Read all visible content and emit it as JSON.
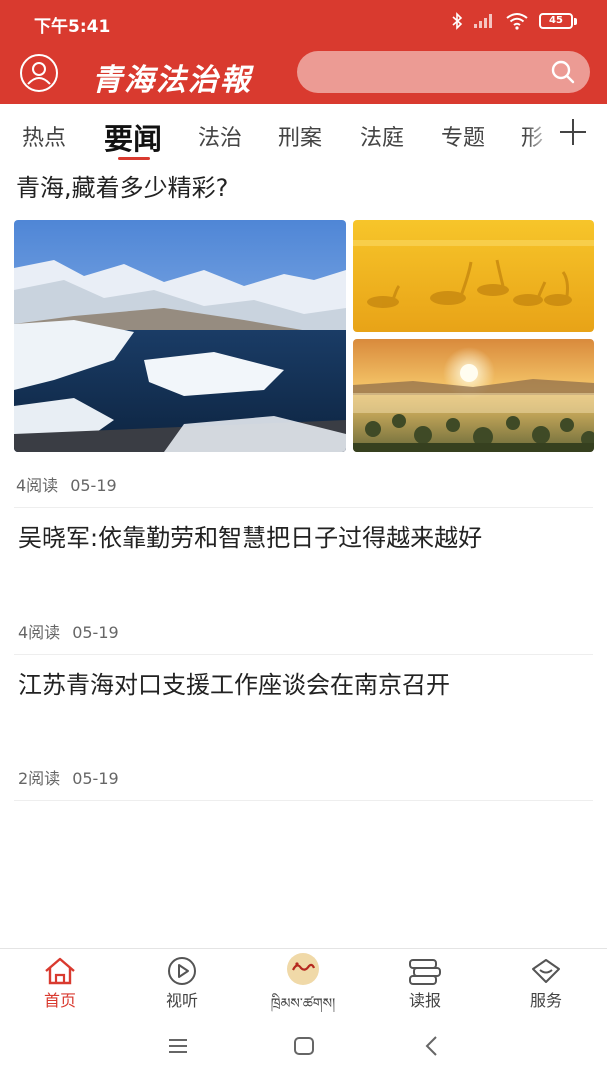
{
  "status_bar": {
    "time": "下午5:41",
    "battery": "45"
  },
  "header": {
    "logo_text": "青海法治報",
    "search_placeholder": ""
  },
  "tabs": [
    {
      "label": "热点",
      "active": false
    },
    {
      "label": "要闻",
      "active": true
    },
    {
      "label": "法治",
      "active": false
    },
    {
      "label": "刑案",
      "active": false
    },
    {
      "label": "法庭",
      "active": false
    },
    {
      "label": "专题",
      "active": false
    },
    {
      "label": "形",
      "active": false
    }
  ],
  "articles": [
    {
      "title": "青海,藏着多少精彩?",
      "reads": "4阅读",
      "date": "05-19"
    },
    {
      "title": "吴晓军:依靠勤劳和智慧把日子过得越来越好",
      "reads": "4阅读",
      "date": "05-19"
    },
    {
      "title": "江苏青海对口支援工作座谈会在南京召开",
      "reads": "2阅读",
      "date": "05-19"
    }
  ],
  "bottom_nav": [
    {
      "label": "首页",
      "icon": "home-icon",
      "active": true
    },
    {
      "label": "视听",
      "icon": "play-icon",
      "active": false
    },
    {
      "label": "ཁྲིམས་ཚགས།",
      "icon": "tibetan-logo-icon",
      "active": false
    },
    {
      "label": "读报",
      "icon": "newspaper-icon",
      "active": false
    },
    {
      "label": "服务",
      "icon": "service-icon",
      "active": false
    }
  ],
  "colors": {
    "brand": "#d93a2f",
    "search_bg": "#ec9b94"
  }
}
